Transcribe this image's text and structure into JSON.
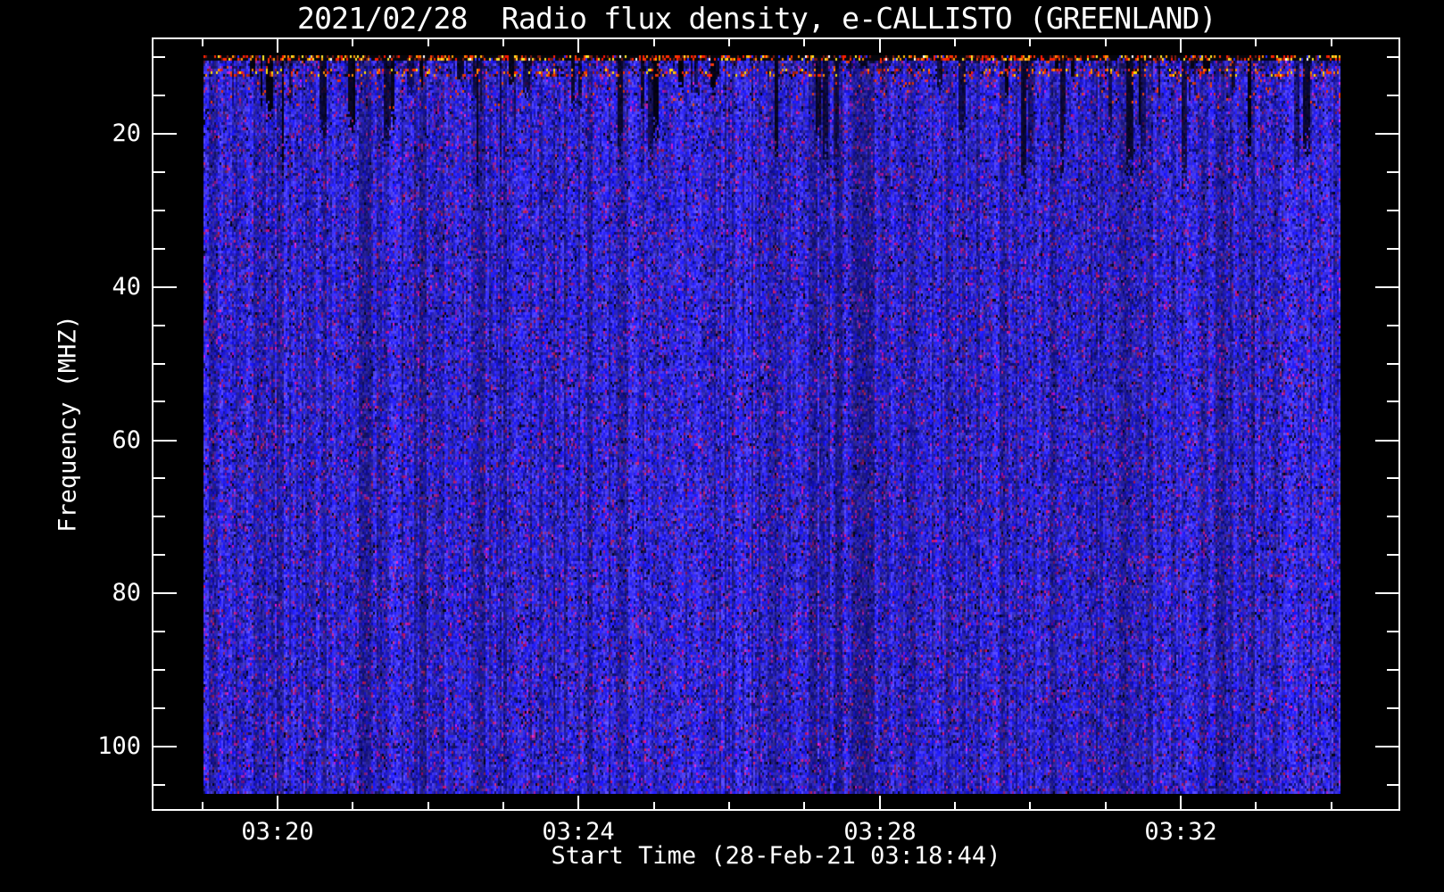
{
  "window": {
    "kind": "radio spectrogram quicklook plot",
    "background_color": "#000000",
    "axis_color": "#ffffff",
    "text_color": "#ffffff"
  },
  "chart_data": {
    "type": "heatmap",
    "title": "2021/02/28  Radio flux density, e-CALLISTO (GREENLAND)",
    "xlabel": "Start Time (28-Feb-21 03:18:44)",
    "ylabel": "Frequency (MHZ)",
    "x_tick_labels": [
      "03:20",
      "03:24",
      "03:28",
      "03:32"
    ],
    "x_minor_tick_step": "1 minute",
    "x_axis_span": "approx 03:19 to 03:35",
    "y_tick_values": [
      20,
      40,
      60,
      80,
      100
    ],
    "y_minor_tick_step_mhz": 5,
    "y_axis_span_mhz": [
      8,
      108
    ],
    "y_axis_orientation": "frequency increases downward",
    "legend": null,
    "colorbar": null,
    "colormap_colors": {
      "background_noise_blue": "#2a2ae8",
      "dim_blue": "#10109a",
      "speckle_purple": "#6a1c78",
      "speckle_dark_red": "#801848",
      "rfi_red": "#ff2200",
      "rfi_orange": "#ff8800",
      "rfi_yellow": "#ffee22",
      "rfi_white": "#ffffff",
      "dropout_black": "#000008"
    },
    "features": [
      "entire dynamic spectrum dominated by bright blue background noise with fine 2-3 px vertical streak texture",
      "sparse dark purple / dark red speckles scattered uniformly through the blue noise",
      "dense bright red/orange/yellow RFI speckle band along the very top edge of the image (near 10 MHz)",
      "second fainter red/orange speckle lane slightly below the top band (near 12-13 MHz)",
      "short dark vertical dropout streaks penetrating the uppermost rows (roughly 10-20 MHz), strongest between about 03:26 and 03:32",
      "no colorbar or legend displayed; white frame with inward-pointing major and minor ticks on all four axes"
    ]
  }
}
